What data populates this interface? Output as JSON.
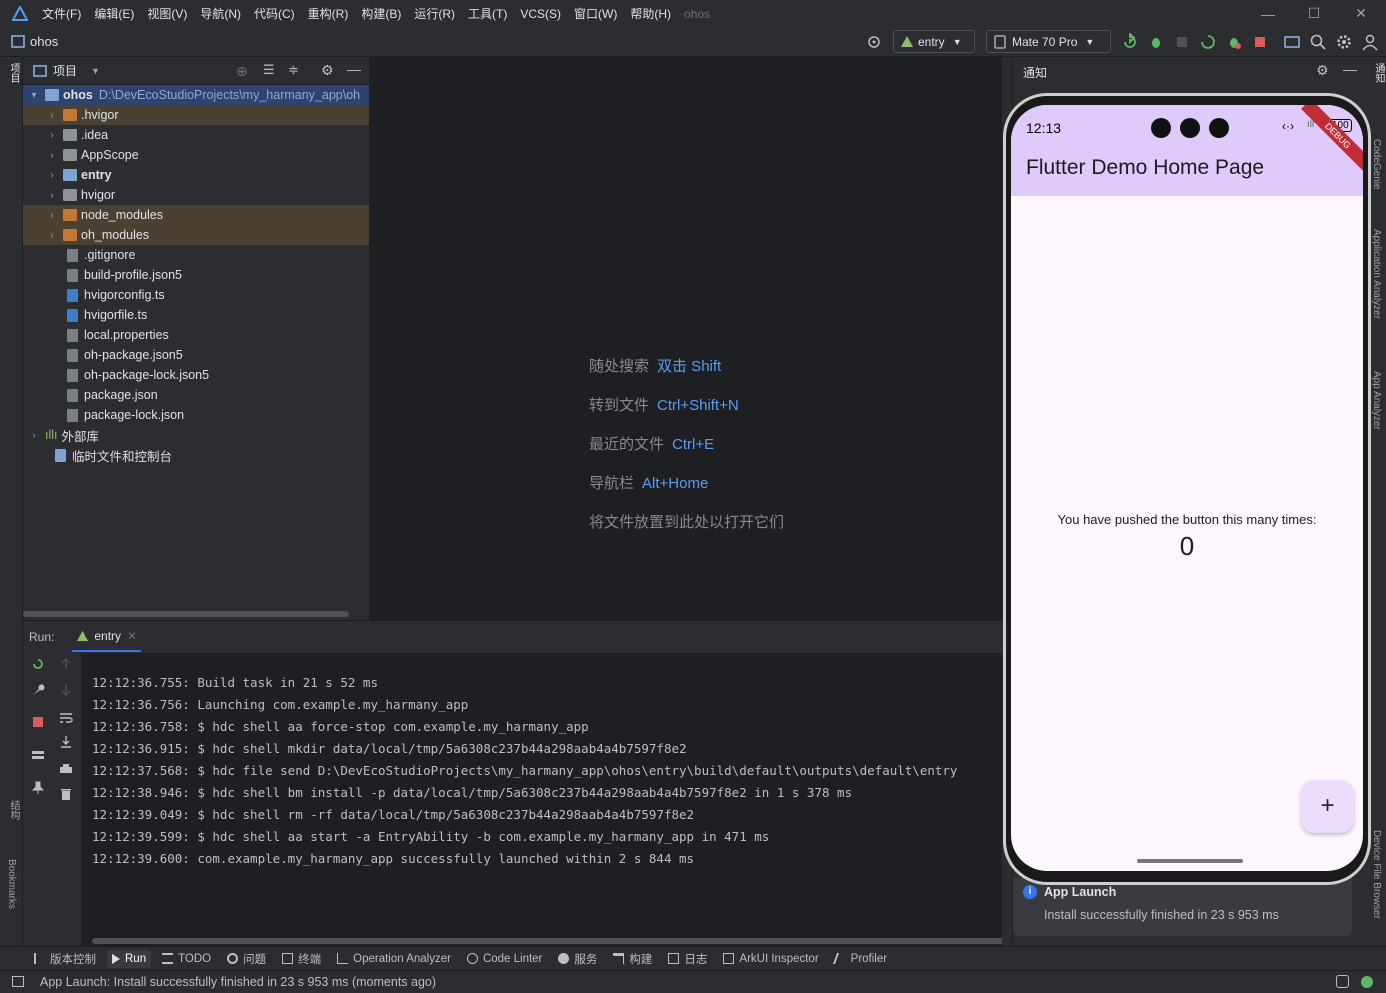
{
  "menu": [
    "文件(F)",
    "编辑(E)",
    "视图(V)",
    "导航(N)",
    "代码(C)",
    "重构(R)",
    "构建(B)",
    "运行(R)",
    "工具(T)",
    "VCS(S)",
    "窗口(W)",
    "帮助(H)"
  ],
  "window_title": "ohos",
  "navbar": {
    "project": "ohos",
    "run_config": "entry",
    "device": "Mate 70 Pro"
  },
  "left_strip": {
    "project_label": "项目",
    "structure_label": "结构",
    "bookmarks_label": "Bookmarks"
  },
  "project_panel": {
    "title": "项目",
    "root": {
      "name": "ohos",
      "path": "D:\\DevEcoStudioProjects\\my_harmany_app\\oh"
    },
    "items": [
      {
        "label": ".hvigor",
        "kind": "folder-excluded"
      },
      {
        "label": ".idea",
        "kind": "folder"
      },
      {
        "label": "AppScope",
        "kind": "folder"
      },
      {
        "label": "entry",
        "kind": "module"
      },
      {
        "label": "hvigor",
        "kind": "folder"
      },
      {
        "label": "node_modules",
        "kind": "folder-excluded"
      },
      {
        "label": "oh_modules",
        "kind": "folder-excluded"
      },
      {
        "label": ".gitignore",
        "kind": "file"
      },
      {
        "label": "build-profile.json5",
        "kind": "file"
      },
      {
        "label": "hvigorconfig.ts",
        "kind": "file-ts"
      },
      {
        "label": "hvigorfile.ts",
        "kind": "file-ts"
      },
      {
        "label": "local.properties",
        "kind": "file"
      },
      {
        "label": "oh-package.json5",
        "kind": "file"
      },
      {
        "label": "oh-package-lock.json5",
        "kind": "file"
      },
      {
        "label": "package.json",
        "kind": "file"
      },
      {
        "label": "package-lock.json",
        "kind": "file"
      }
    ],
    "external_libs": "外部库",
    "scratches": "临时文件和控制台"
  },
  "editor_hints": [
    {
      "text": "随处搜索",
      "key": "双击 Shift"
    },
    {
      "text": "转到文件",
      "key": "Ctrl+Shift+N"
    },
    {
      "text": "最近的文件",
      "key": "Ctrl+E"
    },
    {
      "text": "导航栏",
      "key": "Alt+Home"
    },
    {
      "text": "将文件放置到此处以打开它们",
      "key": ""
    }
  ],
  "run_panel": {
    "label": "Run:",
    "tab": "entry",
    "logs": [
      "12:12:36.755: Build task in 21 s 52 ms",
      "12:12:36.756: Launching com.example.my_harmany_app",
      "12:12:36.758: $ hdc shell aa force-stop com.example.my_harmany_app",
      "12:12:36.915: $ hdc shell mkdir data/local/tmp/5a6308c237b44a298aab4a4b7597f8e2",
      "12:12:37.568: $ hdc file send D:\\DevEcoStudioProjects\\my_harmany_app\\ohos\\entry\\build\\default\\outputs\\default\\entry",
      "12:12:38.946: $ hdc shell bm install -p data/local/tmp/5a6308c237b44a298aab4a4b7597f8e2 in 1 s 378 ms",
      "12:12:39.049: $ hdc shell rm -rf data/local/tmp/5a6308c237b44a298aab4a4b7597f8e2",
      "12:12:39.599: $ hdc shell aa start -a EntryAbility -b com.example.my_harmany_app in 471 ms",
      "12:12:39.600: com.example.my_harmany_app successfully launched within 2 s 844 ms"
    ]
  },
  "notifications": {
    "title": "通知",
    "toast_title": "App Launch",
    "toast_body": "Install successfully finished in 23 s 953 ms"
  },
  "phone": {
    "time": "12:13",
    "battery": "100",
    "debug_banner": "DEBUG",
    "app_title": "Flutter Demo Home Page",
    "message": "You have pushed the button this many times:",
    "counter": "0",
    "fab": "+"
  },
  "right_strip": [
    "通知",
    "CodeGenie",
    "Application Analyzer",
    "App Analyzer",
    "Device File Browser"
  ],
  "toolwindows": [
    "版本控制",
    "Run",
    "TODO",
    "问题",
    "终端",
    "Operation Analyzer",
    "Code Linter",
    "服务",
    "构建",
    "日志",
    "ArkUI Inspector",
    "Profiler"
  ],
  "status": "App Launch: Install successfully finished in 23 s 953 ms (moments ago)",
  "colors": {
    "accent": "#3574f0",
    "link": "#589df6",
    "app_bar": "#dfcafc",
    "screen_bg": "#fef7ff"
  }
}
